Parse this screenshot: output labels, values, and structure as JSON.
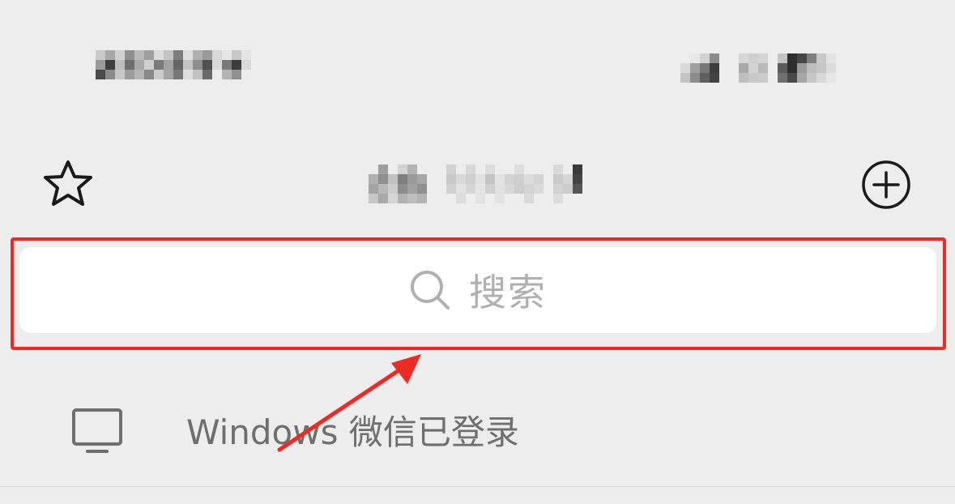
{
  "header": {
    "title_obscured": true
  },
  "search": {
    "label": "搜索"
  },
  "device_notice": {
    "text": "Windows 微信已登录"
  },
  "icons": {
    "favorite": "star-icon",
    "add": "plus-circle-icon",
    "search": "search-icon",
    "device": "monitor-icon"
  },
  "colors": {
    "highlight": "#ee2a24",
    "background": "#ededed",
    "search_bg": "#ffffff",
    "placeholder": "#b0b0b0"
  }
}
